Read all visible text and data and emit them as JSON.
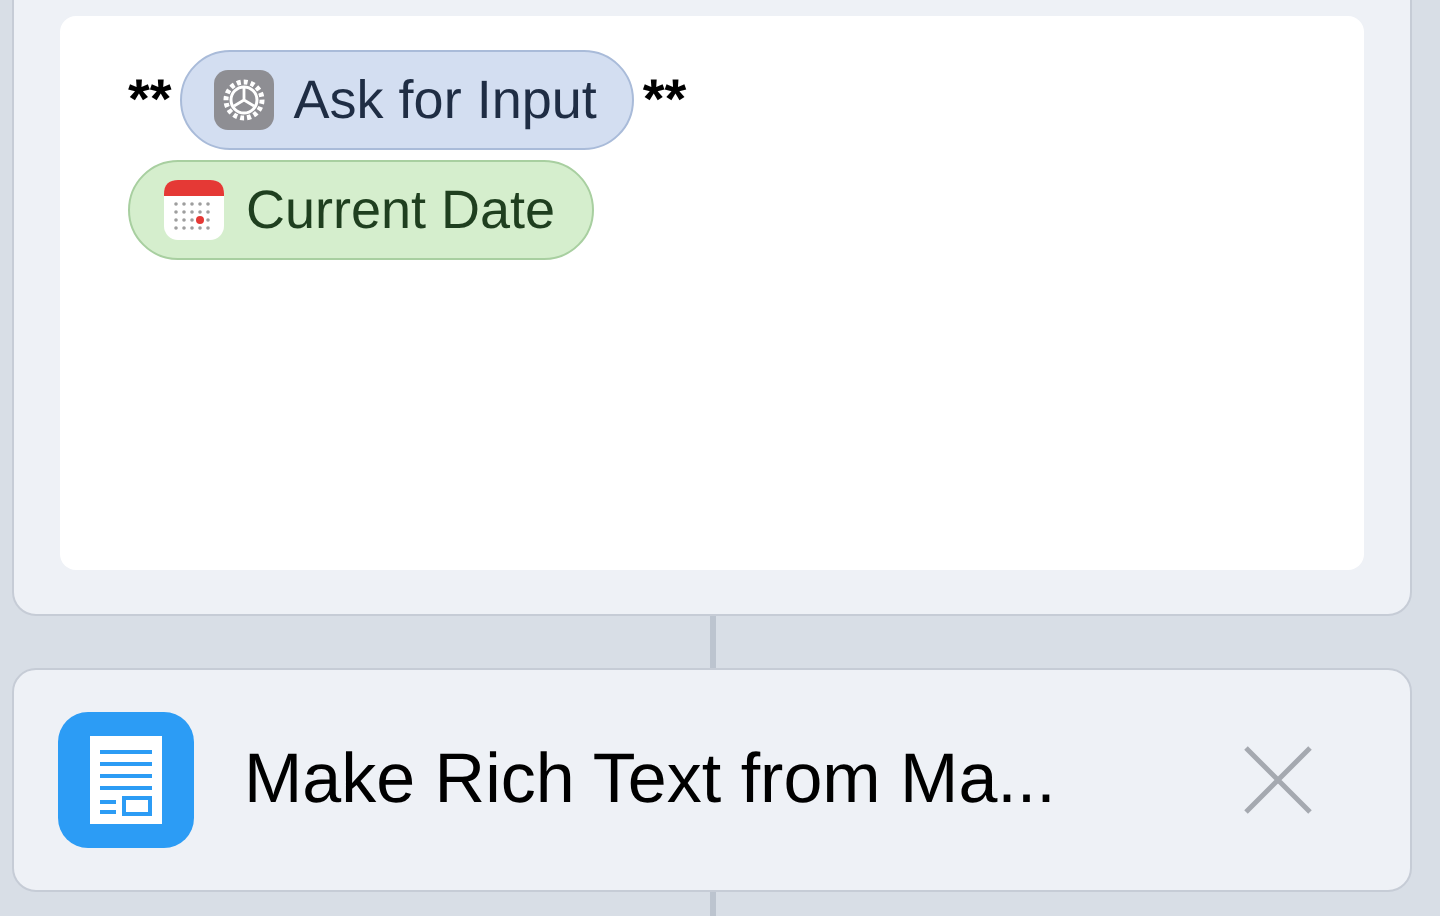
{
  "text_card": {
    "lines": [
      [
        {
          "kind": "text",
          "text": "**"
        },
        {
          "kind": "input_token",
          "text": "Ask for Input"
        },
        {
          "kind": "text",
          "text": "**"
        }
      ],
      [
        {
          "kind": "date_token",
          "text": "Current Date"
        }
      ]
    ]
  },
  "action_card": {
    "title": "Make Rich Text from Ma..."
  }
}
